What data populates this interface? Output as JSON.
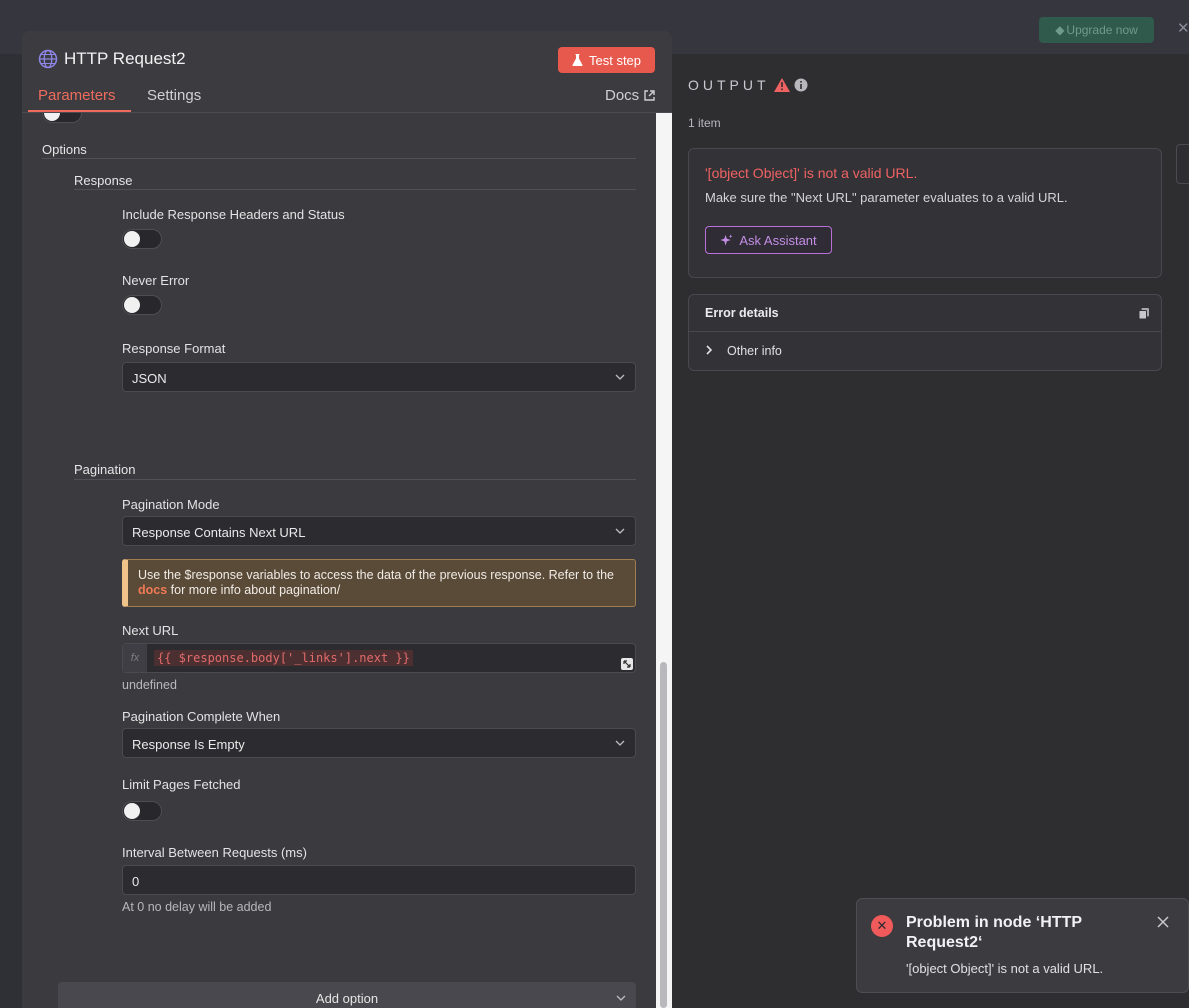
{
  "topbar": {
    "upgrade_label": "Upgrade now",
    "close_glyph": "✕"
  },
  "node": {
    "title": "HTTP Request2",
    "icon": "globe-icon"
  },
  "header": {
    "test_step_label": "Test step",
    "tabs": [
      {
        "label": "Parameters",
        "active": true
      },
      {
        "label": "Settings",
        "active": false
      }
    ],
    "docs_label": "Docs"
  },
  "params": {
    "options_label": "Options",
    "response_section": "Response",
    "include_headers_label": "Include Response Headers and Status",
    "never_error_label": "Never Error",
    "response_format_label": "Response Format",
    "response_format_value": "JSON",
    "pagination_section": "Pagination",
    "pagination_mode_label": "Pagination Mode",
    "pagination_mode_value": "Response Contains Next URL",
    "notice_text": "Use the $response variables to access the data of the previous response. Refer to the",
    "notice_link": "docs",
    "notice_tail": "for more info about pagination/",
    "next_url_label": "Next URL",
    "next_url_expression": "{{ $response.body['_links'].next }}",
    "next_url_result": "undefined",
    "complete_when_label": "Pagination Complete When",
    "complete_when_value": "Response Is Empty",
    "limit_pages_label": "Limit Pages Fetched",
    "interval_label": "Interval Between Requests (ms)",
    "interval_value": "0",
    "interval_hint": "At 0 no delay will be added",
    "add_option_label": "Add option"
  },
  "output": {
    "title": "OUTPUT",
    "items_count": "1 item",
    "error_title": "'[object Object]' is not a valid URL.",
    "error_message": "Make sure the \"Next URL\" parameter evaluates to a valid URL.",
    "ask_assistant_label": "Ask Assistant",
    "details_title": "Error details",
    "other_info_label": "Other info"
  },
  "toast": {
    "title": "Problem in node ‘HTTP Request2‘",
    "message": "'[object Object]' is not a valid URL."
  },
  "colors": {
    "accent": "#ef6b5d",
    "error": "#f06262",
    "warning_bg": "#5a4a38",
    "assistant": "#c48ee6"
  }
}
